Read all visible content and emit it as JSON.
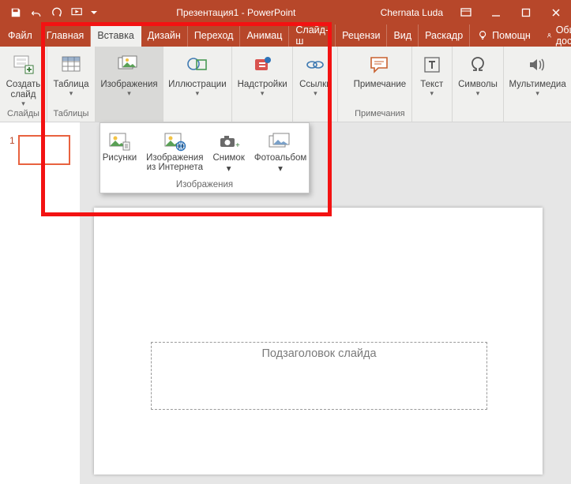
{
  "titlebar": {
    "doc_title": "Презентация1 - PowerPoint",
    "user": "Chernata Luda"
  },
  "tabs": {
    "file": "Файл",
    "items": [
      "Главная",
      "Вставка",
      "Дизайн",
      "Переход",
      "Анимац",
      "Слайд-ш",
      "Рецензи",
      "Вид",
      "Раскадр"
    ],
    "active_index": 1,
    "tell_me": "Помощн",
    "share": "Общий доступ"
  },
  "ribbon": {
    "new_slide": "Создать\nслайд",
    "slides_group": "Слайды",
    "table": "Таблица",
    "tables_group": "Таблицы",
    "images": "Изображения",
    "illustrations": "Иллюстрации",
    "addins": "Надстройки",
    "links": "Ссылки",
    "comment": "Примечание",
    "comments_group": "Примечания",
    "text": "Текст",
    "symbols": "Символы",
    "media": "Мультимедиа"
  },
  "dropdown": {
    "pictures": "Рисунки",
    "online_pictures": "Изображения\nиз Интернета",
    "screenshot": "Снимок",
    "photo_album": "Фотоальбом",
    "group_label": "Изображения"
  },
  "slides_pane": {
    "thumb_num": "1"
  },
  "canvas": {
    "placeholder": "Подзаголовок слайда"
  }
}
